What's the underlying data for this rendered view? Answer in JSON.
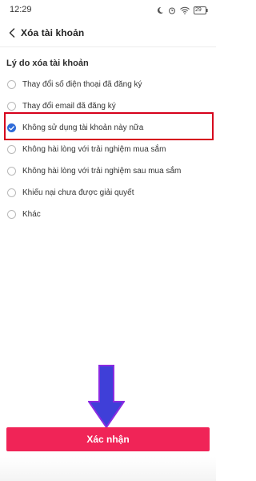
{
  "status_bar": {
    "time": "12:29",
    "battery": "29",
    "icons": [
      "moon-icon",
      "alarm-icon",
      "wifi-icon",
      "battery-icon"
    ]
  },
  "header": {
    "back_icon": "chevron-left-icon",
    "title": "Xóa tài khoản"
  },
  "section_title": "Lý do xóa tài khoản",
  "reasons": [
    {
      "label": "Thay đổi số điện thoại đã đăng ký",
      "selected": false
    },
    {
      "label": "Thay đổi email đã đăng ký",
      "selected": false
    },
    {
      "label": "Không sử dụng tài khoản này nữa",
      "selected": true
    },
    {
      "label": "Không hài lòng với trải nghiệm mua sắm",
      "selected": false
    },
    {
      "label": "Không hài lòng với trải nghiệm sau mua sắm",
      "selected": false
    },
    {
      "label": "Khiếu nại chưa được giải quyết",
      "selected": false
    },
    {
      "label": "Khác",
      "selected": false
    }
  ],
  "confirm_button": {
    "label": "Xác nhận"
  },
  "colors": {
    "accent": "#f02457",
    "radio_checked": "#2f6bd8",
    "highlight_box": "#d6001c",
    "arrow_fill": "#3f3fd8",
    "arrow_stroke": "#8a2be2"
  }
}
